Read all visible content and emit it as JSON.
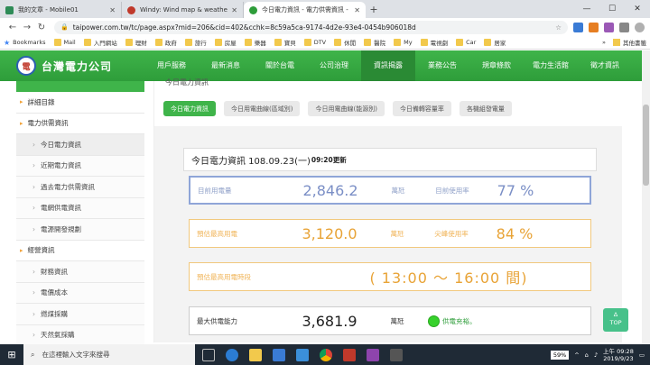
{
  "browser": {
    "tabs": [
      {
        "title": "我的文章 - Mobile01",
        "color": "#2e8b57"
      },
      {
        "title": "Windy: Wind map & weather f",
        "color": "#c0392b"
      },
      {
        "title": "今日電力資訊 - 電力供需資訊 - 台",
        "color": "#2e9d3a"
      }
    ],
    "window_controls": [
      "—",
      "☐",
      "✕"
    ],
    "url": "taipower.com.tw/tc/page.aspx?mid=206&cid=402&cchk=8c59a5ca-9174-4d2e-93e4-0454b906018d",
    "bookmarks": [
      "Bookmarks",
      "Mail",
      "入門網站",
      "理財",
      "政府",
      "旅行",
      "房屋",
      "樂器",
      "寶貝",
      "DTV",
      "休閒",
      "醫院",
      "My",
      "電視劇",
      "Car",
      "居家"
    ],
    "bookmarks_overflow": "»",
    "other_bookmarks": "其他書籤"
  },
  "site": {
    "logo_text": "台灣電力公司",
    "logo_emblem": "電",
    "menu": [
      "用戶服務",
      "最新消息",
      "關於台電",
      "公司治理",
      "資訊揭露",
      "業務公告",
      "規章條款",
      "電力生活館",
      "徵才資訊"
    ],
    "active_menu_index": 4
  },
  "sidebar": {
    "items": [
      {
        "label": "詳細目錄",
        "level": 1
      },
      {
        "label": "電力供需資訊",
        "level": 1
      },
      {
        "label": "今日電力資訊",
        "level": 2,
        "current": true
      },
      {
        "label": "近期電力資訊",
        "level": 2
      },
      {
        "label": "過去電力供需資訊",
        "level": 2
      },
      {
        "label": "電網供電資訊",
        "level": 2
      },
      {
        "label": "電源開發規劃",
        "level": 2
      },
      {
        "label": "經營資訊",
        "level": 1
      },
      {
        "label": "財務資訊",
        "level": 2
      },
      {
        "label": "電價成本",
        "level": 2
      },
      {
        "label": "燃煤採購",
        "level": 2
      },
      {
        "label": "天然氣採購",
        "level": 2
      }
    ]
  },
  "main": {
    "crumb": "今日電力資訊",
    "tabs": [
      "今日電力資訊",
      "今日用電曲線(區域別)",
      "今日用電曲線(能源別)",
      "今日備轉容量率",
      "各機組發電量"
    ],
    "active_tab_index": 0,
    "header_title": "今日電力資訊 108.09.23(一)",
    "header_update": "09:20更新",
    "rows": {
      "current": {
        "label": "目前用電量",
        "value": "2,846.2",
        "unit": "萬瓩",
        "rate_label": "目前使用率",
        "rate": "77 %"
      },
      "forecast": {
        "label": "預估最高用電",
        "value": "3,120.0",
        "unit": "萬瓩",
        "rate_label": "尖峰使用率",
        "rate": "84 %"
      },
      "peak_time": {
        "label": "預估最高用電時段",
        "value": "( 13:00 ～ 16:00  間)"
      },
      "capacity": {
        "label": "最大供電能力",
        "value": "3,681.9",
        "unit": "萬瓩",
        "status": "供電充裕。"
      }
    },
    "top_button": {
      "arrow": "Δ",
      "label": "TOP"
    }
  },
  "taskbar": {
    "search_placeholder": "在這裡輸入文字來搜尋",
    "battery": "59%",
    "time": "上午 09:28",
    "date": "2019/9/23"
  }
}
